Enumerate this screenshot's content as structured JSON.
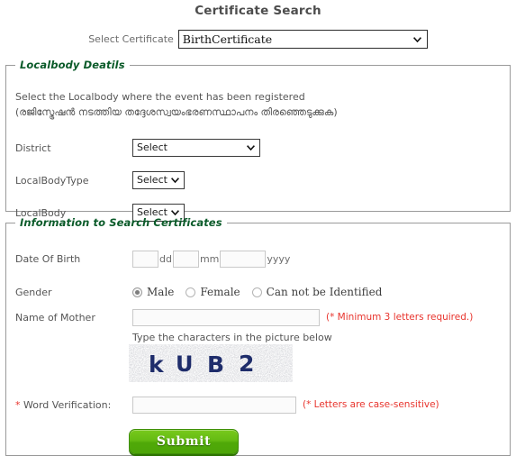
{
  "page": {
    "title": "Certificate Search"
  },
  "certificate": {
    "label": "Select Certificate",
    "selected": "BirthCertificate"
  },
  "localbody": {
    "legend": "Localbody Deatils",
    "hint_en": "Select the Localbody where the event has been registered",
    "hint_ml": "(രജിസ്ട്രേഷൻ നടത്തിയ തദ്ദേശസ്വയംഭരണസ്ഥാപനം തിരഞ്ഞെടുക്കുക)",
    "district": {
      "label": "District",
      "selected": "Select"
    },
    "localbodytype": {
      "label": "LocalBodyType",
      "selected": "Select"
    },
    "localbodyname": {
      "label": "LocalBody",
      "selected": "Select"
    }
  },
  "info": {
    "legend": "Information to Search Certificates",
    "dob": {
      "label": "Date Of Birth",
      "dd_value": "",
      "dd_unit": "dd",
      "mm_value": "",
      "mm_unit": "mm",
      "yyyy_value": "",
      "yyyy_unit": "yyyy"
    },
    "gender": {
      "label": "Gender",
      "options": [
        {
          "label": "Male",
          "selected": true
        },
        {
          "label": "Female",
          "selected": false
        },
        {
          "label": "Can not be Identified",
          "selected": false
        }
      ]
    },
    "mother": {
      "label": "Name of Mother",
      "value": "",
      "note": "(* Minimum 3 letters required.)"
    },
    "captcha": {
      "hint": "Type the characters in the picture below",
      "text": "kUB2",
      "chars": [
        "k",
        "U",
        "B",
        "2"
      ],
      "text_color": "#1f2d6b"
    },
    "verification": {
      "star": "*",
      "label": "Word Verification:",
      "value": "",
      "note": "(* Letters are case-sensitive)"
    },
    "submit_label": "Submit"
  },
  "colors": {
    "legend_green": "#0b5b2a",
    "note_red": "#e8342d",
    "submit_green": "#65bb13",
    "captcha_navy": "#1f2d6b"
  }
}
